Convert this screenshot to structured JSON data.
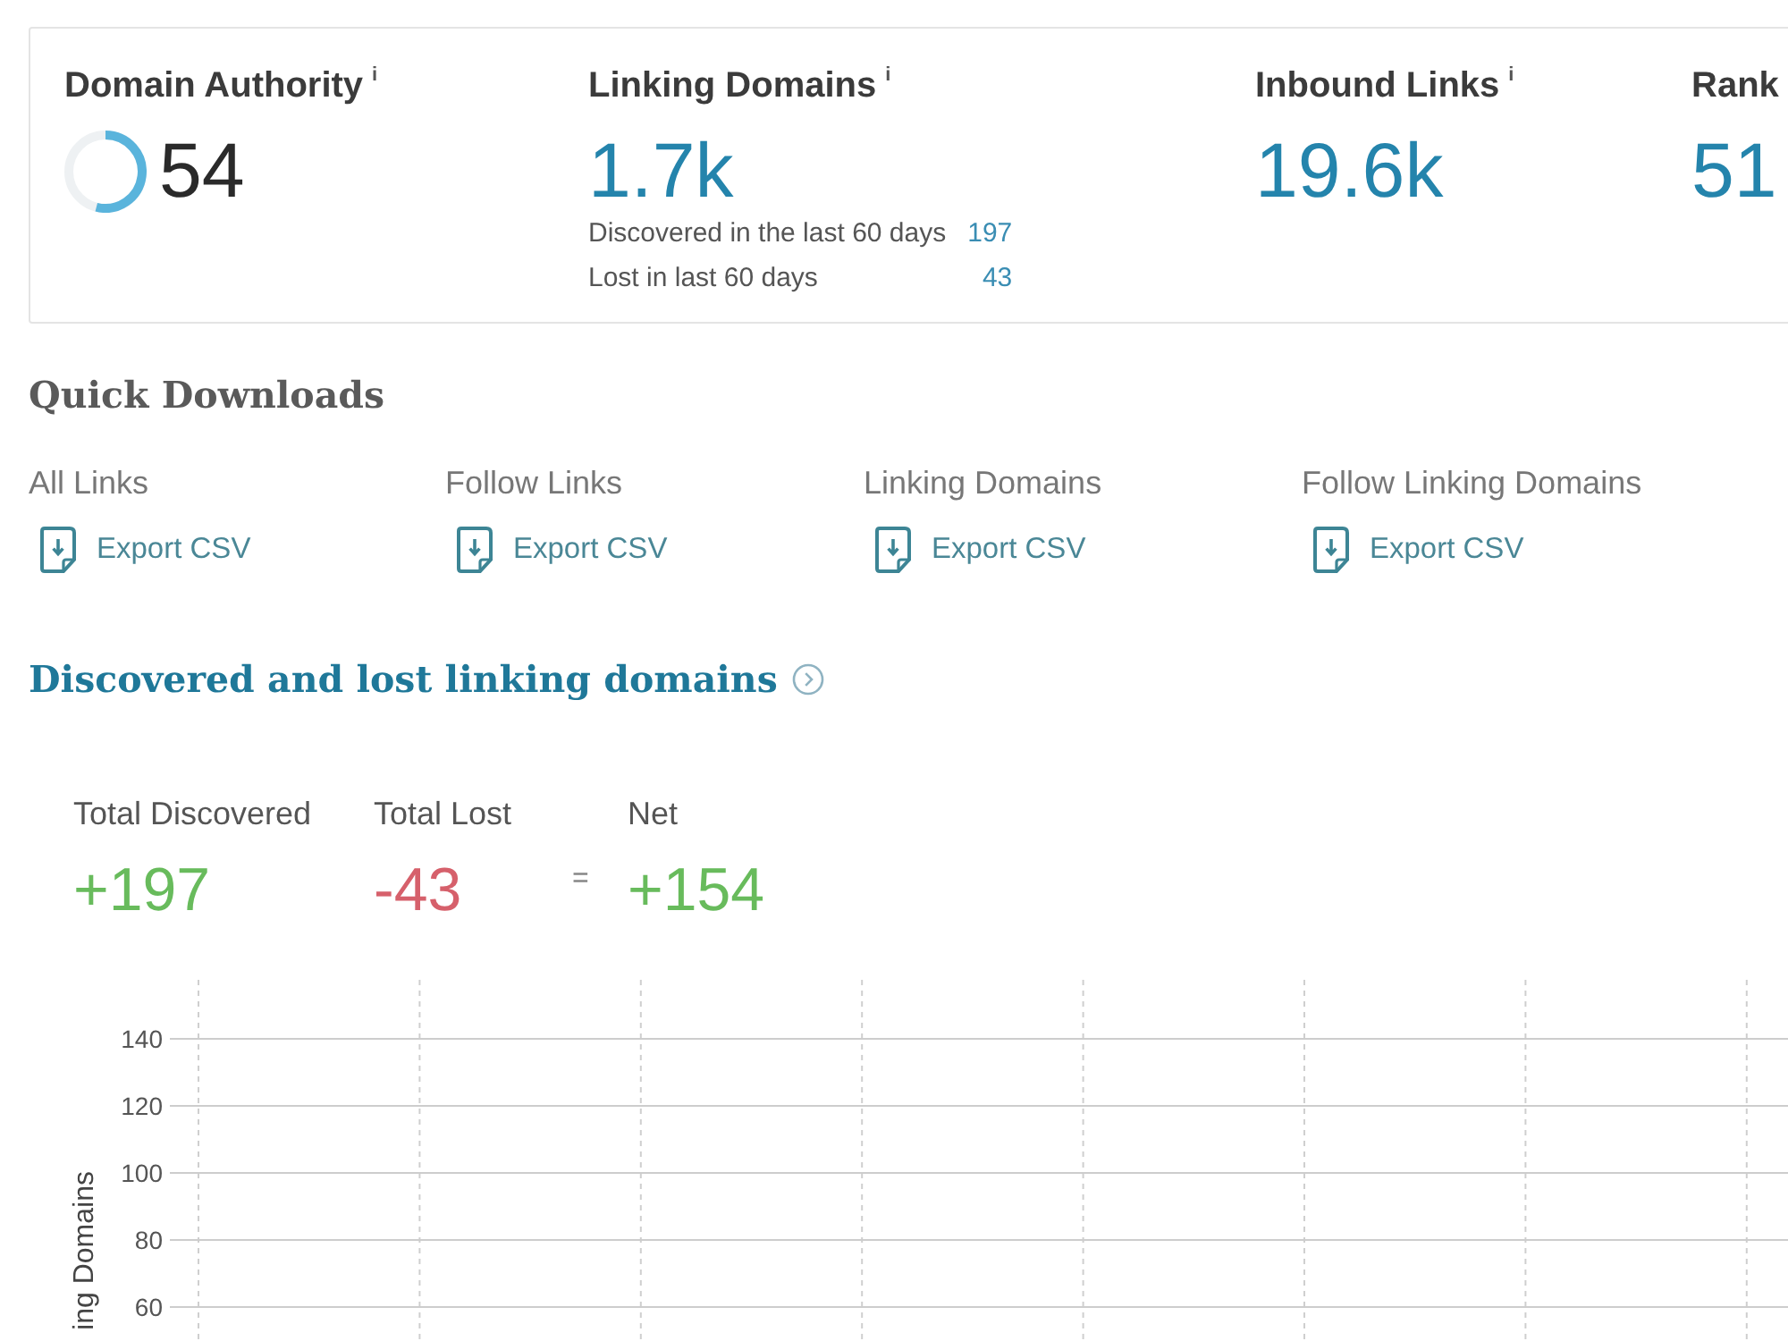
{
  "metrics": [
    {
      "title": "Domain Authority",
      "info": "i",
      "value": "54",
      "kind": "ring",
      "level": 0.54
    },
    {
      "title": "Linking Domains",
      "info": "i",
      "value": "1.7k",
      "kind": "plain",
      "details": [
        {
          "label": "Discovered in the last 60 days",
          "value": "197"
        },
        {
          "label": "Lost in last 60 days",
          "value": "43"
        }
      ]
    },
    {
      "title": "Inbound Links",
      "info": "i",
      "value": "19.6k",
      "kind": "plain"
    },
    {
      "title": "Rank",
      "value": "51",
      "kind": "plain"
    }
  ],
  "quick_downloads": {
    "title": "Quick Downloads",
    "items": [
      {
        "label": "All Links",
        "link": "Export CSV"
      },
      {
        "label": "Follow Links",
        "link": "Export CSV"
      },
      {
        "label": "Linking Domains",
        "link": "Export CSV"
      },
      {
        "label": "Follow Linking Domains",
        "link": "Export CSV"
      }
    ]
  },
  "discovered_lost": {
    "title": "Discovered and lost linking domains",
    "totals": [
      {
        "label": "Total Discovered",
        "value": "+197",
        "kind": "gain"
      },
      {
        "label": "Total Lost",
        "value": "-43",
        "kind": "loss"
      },
      {
        "label": "Net",
        "value": "+154",
        "kind": "gain"
      }
    ],
    "equals_sign": "=",
    "chart_grid": {
      "y_axis_label": "ing Domains",
      "y_tick_labels": [
        "140",
        "120",
        "100",
        "80",
        "60"
      ]
    }
  }
}
